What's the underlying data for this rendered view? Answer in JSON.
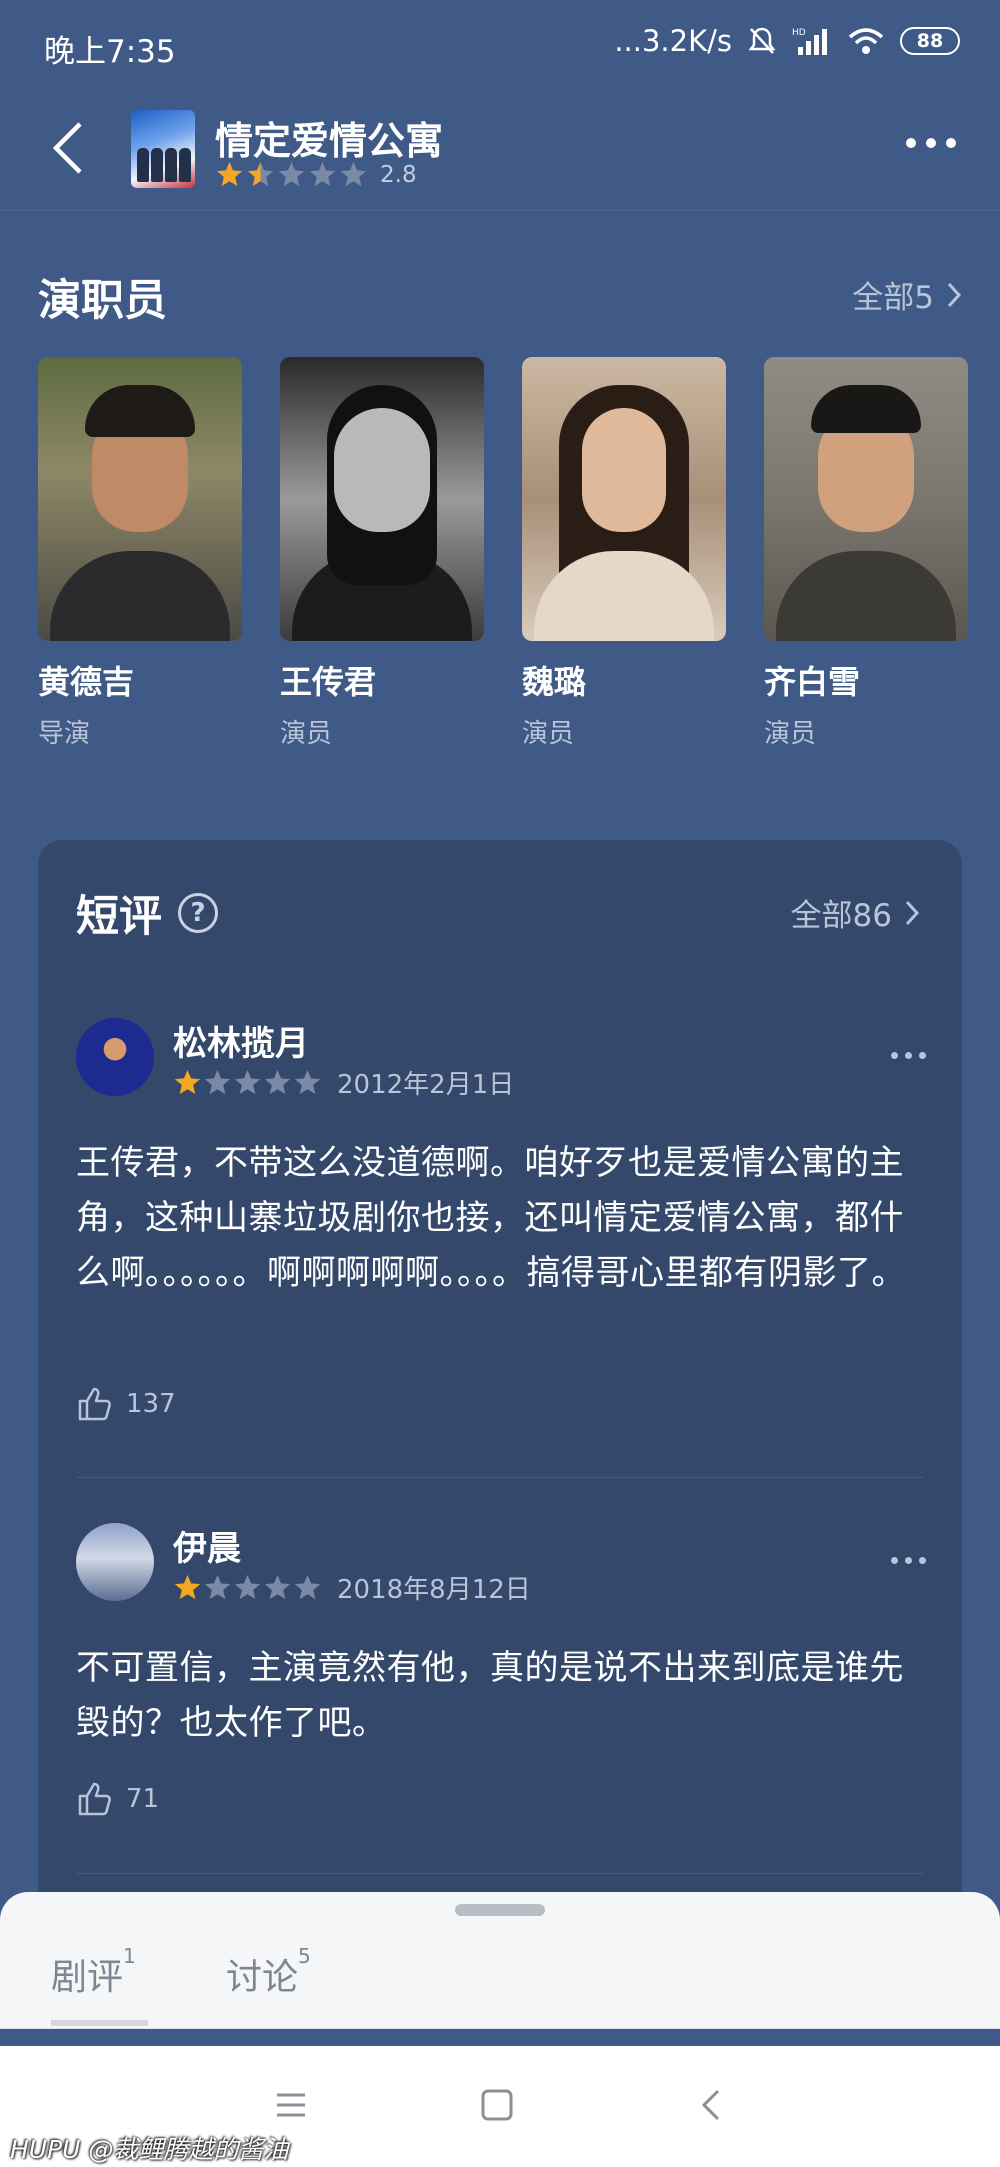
{
  "status_bar": {
    "time": "晚上7:35",
    "network_speed": "...3.2K/s",
    "battery": "88"
  },
  "header": {
    "title": "情定爱情公寓",
    "rating": "2.8",
    "star_fill": 0.3
  },
  "cast": {
    "title": "演职员",
    "see_all": "全部5",
    "items": [
      {
        "name": "黄德吉",
        "role": "导演"
      },
      {
        "name": "王传君",
        "role": "演员"
      },
      {
        "name": "魏璐",
        "role": "演员"
      },
      {
        "name": "齐白雪",
        "role": "演员"
      }
    ]
  },
  "reviews": {
    "title": "短评",
    "see_all": "全部86",
    "items": [
      {
        "user": "松林揽月",
        "stars": 1,
        "date": "2012年2月1日",
        "text": "王传君，不带这么没道德啊。咱好歹也是爱情公寓的主角，这种山寨垃圾剧你也接，还叫情定爱情公寓，都什么啊。。。。。。啊啊啊啊啊。。。。搞得哥心里都有阴影了。",
        "likes": "137"
      },
      {
        "user": "伊晨",
        "stars": 1,
        "date": "2018年8月12日",
        "text": "不可置信，主演竟然有他，真的是说不出来到底是谁先毁的？也太作了吧。",
        "likes": "71"
      }
    ]
  },
  "bottom_tabs": [
    {
      "label": "剧评",
      "count": "1"
    },
    {
      "label": "讨论",
      "count": "5"
    }
  ],
  "watermark": "HUPU @裁鲤腾越的酱油",
  "colors": {
    "star_active": "#f5a623",
    "star_inactive": "#7a8aa6",
    "background": "#3f5a86",
    "card": "#33486b"
  }
}
